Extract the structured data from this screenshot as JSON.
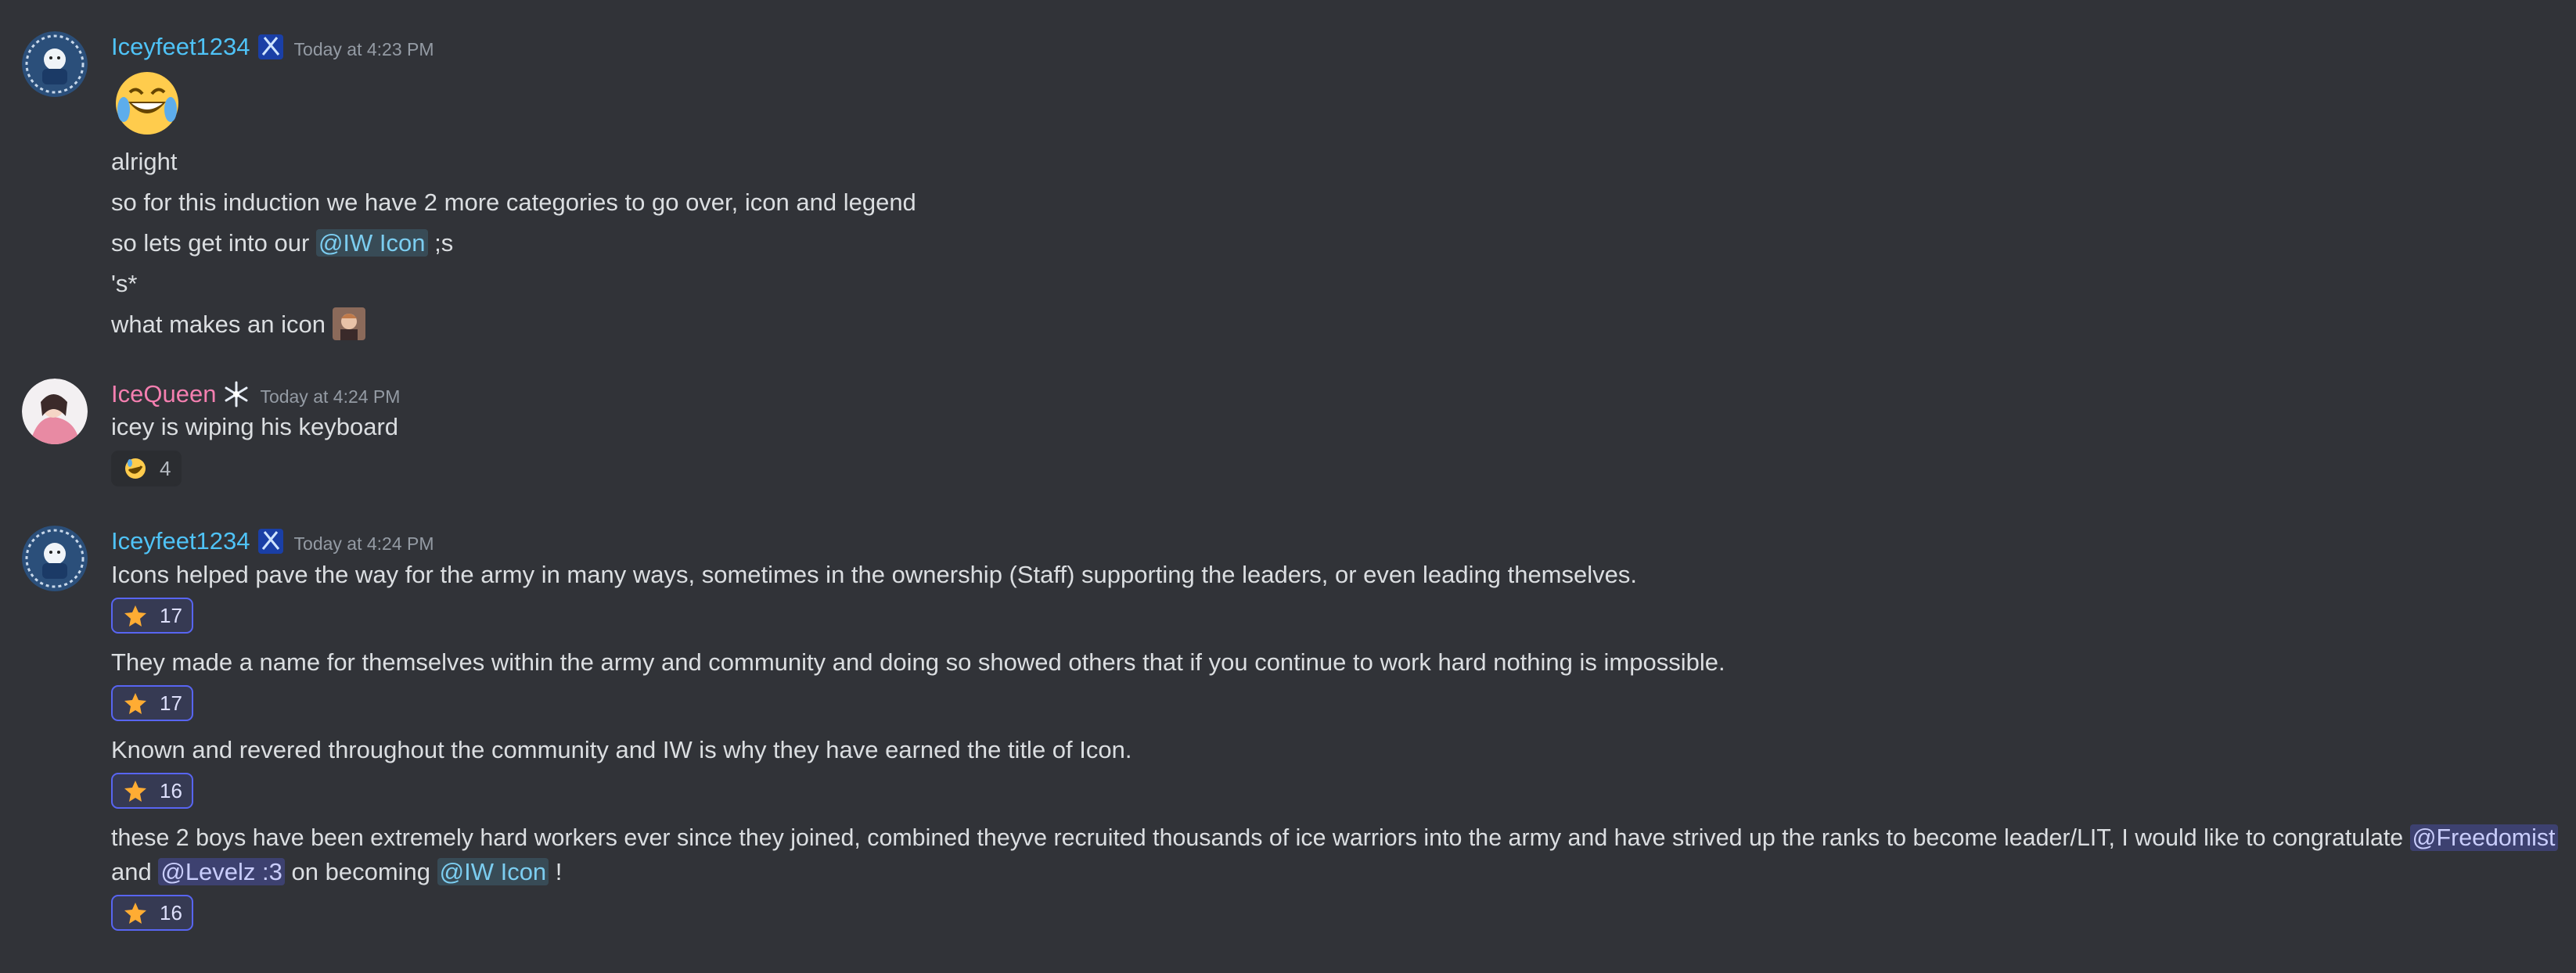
{
  "messages": [
    {
      "username": "Iceyfeet1234",
      "username_color": "#4fc3f7",
      "timestamp": "Today at 4:23 PM",
      "lines": {
        "l1": "alright",
        "l2": "so for this induction we have 2 more categories to go over, icon and legend",
        "l3_pre": "so lets get into our ",
        "l3_mention": "@IW Icon",
        "l3_post": " ;s",
        "l4": "'s*",
        "l5": "what makes an icon"
      }
    },
    {
      "username": "IceQueen",
      "username_color": "#f47fb0",
      "timestamp": "Today at 4:24 PM",
      "text": "icey is wiping his keyboard",
      "reaction_count": "4"
    },
    {
      "username": "Iceyfeet1234",
      "username_color": "#4fc3f7",
      "timestamp": "Today at 4:24 PM",
      "p1": "Icons helped pave the way for the army in many ways, sometimes in the ownership (Staff) supporting the leaders, or even leading themselves.",
      "p1_reaction": "17",
      "p2": "They made a name for themselves within the army and community and doing so showed others that if you continue to work hard nothing is impossible.",
      "p2_reaction": "17",
      "p3": "Known and revered throughout the community and IW is why they have earned the title of Icon.",
      "p3_reaction": "16",
      "p4_line1": "these 2 boys have been extremely hard workers ever since they joined, combined theyve recruited thousands of ice warriors into the army and have strived up the ranks to become leader/LIT, I would like to congratulate ",
      "p4_mention1": "@Freedomist",
      "p4_line2_pre": "and ",
      "p4_mention2": "@Levelz :3",
      "p4_line2_mid": " on becoming ",
      "p4_mention3": "@IW Icon",
      "p4_line2_post": " !",
      "p4_reaction": "16"
    }
  ],
  "icons": {
    "reaction_star": "star-emoji",
    "reaction_laugh": "rofl-emoji",
    "big_emoji": "joy-emoji",
    "badge": "hockey-sticks-badge",
    "iceyqueen_badge": "snowflake-badge"
  }
}
